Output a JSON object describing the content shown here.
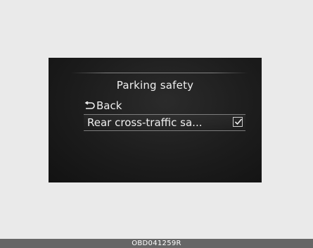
{
  "screen": {
    "title": "Parking safety",
    "menu": {
      "back_label": "Back",
      "back_icon": "back-arrow-icon",
      "items": [
        {
          "label": "Rear cross-traffic sa...",
          "checked": true,
          "check_icon": "checkbox-checked-icon"
        }
      ]
    }
  },
  "footer": {
    "code": "OBD041259R"
  },
  "colors": {
    "screen_bg": "#1c1c1c",
    "text": "#efefef",
    "footer_bg": "#666666",
    "page_bg": "#eaeaea"
  }
}
